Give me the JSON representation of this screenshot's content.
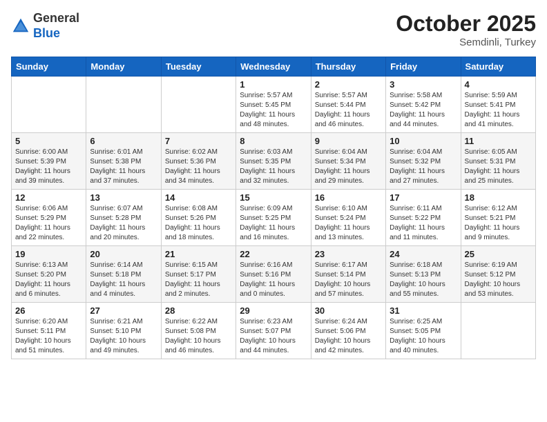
{
  "header": {
    "logo_line1": "General",
    "logo_line2": "Blue",
    "month": "October 2025",
    "location": "Semdinli, Turkey"
  },
  "days_of_week": [
    "Sunday",
    "Monday",
    "Tuesday",
    "Wednesday",
    "Thursday",
    "Friday",
    "Saturday"
  ],
  "weeks": [
    [
      {
        "day": "",
        "content": ""
      },
      {
        "day": "",
        "content": ""
      },
      {
        "day": "",
        "content": ""
      },
      {
        "day": "1",
        "content": "Sunrise: 5:57 AM\nSunset: 5:45 PM\nDaylight: 11 hours\nand 48 minutes."
      },
      {
        "day": "2",
        "content": "Sunrise: 5:57 AM\nSunset: 5:44 PM\nDaylight: 11 hours\nand 46 minutes."
      },
      {
        "day": "3",
        "content": "Sunrise: 5:58 AM\nSunset: 5:42 PM\nDaylight: 11 hours\nand 44 minutes."
      },
      {
        "day": "4",
        "content": "Sunrise: 5:59 AM\nSunset: 5:41 PM\nDaylight: 11 hours\nand 41 minutes."
      }
    ],
    [
      {
        "day": "5",
        "content": "Sunrise: 6:00 AM\nSunset: 5:39 PM\nDaylight: 11 hours\nand 39 minutes."
      },
      {
        "day": "6",
        "content": "Sunrise: 6:01 AM\nSunset: 5:38 PM\nDaylight: 11 hours\nand 37 minutes."
      },
      {
        "day": "7",
        "content": "Sunrise: 6:02 AM\nSunset: 5:36 PM\nDaylight: 11 hours\nand 34 minutes."
      },
      {
        "day": "8",
        "content": "Sunrise: 6:03 AM\nSunset: 5:35 PM\nDaylight: 11 hours\nand 32 minutes."
      },
      {
        "day": "9",
        "content": "Sunrise: 6:04 AM\nSunset: 5:34 PM\nDaylight: 11 hours\nand 29 minutes."
      },
      {
        "day": "10",
        "content": "Sunrise: 6:04 AM\nSunset: 5:32 PM\nDaylight: 11 hours\nand 27 minutes."
      },
      {
        "day": "11",
        "content": "Sunrise: 6:05 AM\nSunset: 5:31 PM\nDaylight: 11 hours\nand 25 minutes."
      }
    ],
    [
      {
        "day": "12",
        "content": "Sunrise: 6:06 AM\nSunset: 5:29 PM\nDaylight: 11 hours\nand 22 minutes."
      },
      {
        "day": "13",
        "content": "Sunrise: 6:07 AM\nSunset: 5:28 PM\nDaylight: 11 hours\nand 20 minutes."
      },
      {
        "day": "14",
        "content": "Sunrise: 6:08 AM\nSunset: 5:26 PM\nDaylight: 11 hours\nand 18 minutes."
      },
      {
        "day": "15",
        "content": "Sunrise: 6:09 AM\nSunset: 5:25 PM\nDaylight: 11 hours\nand 16 minutes."
      },
      {
        "day": "16",
        "content": "Sunrise: 6:10 AM\nSunset: 5:24 PM\nDaylight: 11 hours\nand 13 minutes."
      },
      {
        "day": "17",
        "content": "Sunrise: 6:11 AM\nSunset: 5:22 PM\nDaylight: 11 hours\nand 11 minutes."
      },
      {
        "day": "18",
        "content": "Sunrise: 6:12 AM\nSunset: 5:21 PM\nDaylight: 11 hours\nand 9 minutes."
      }
    ],
    [
      {
        "day": "19",
        "content": "Sunrise: 6:13 AM\nSunset: 5:20 PM\nDaylight: 11 hours\nand 6 minutes."
      },
      {
        "day": "20",
        "content": "Sunrise: 6:14 AM\nSunset: 5:18 PM\nDaylight: 11 hours\nand 4 minutes."
      },
      {
        "day": "21",
        "content": "Sunrise: 6:15 AM\nSunset: 5:17 PM\nDaylight: 11 hours\nand 2 minutes."
      },
      {
        "day": "22",
        "content": "Sunrise: 6:16 AM\nSunset: 5:16 PM\nDaylight: 11 hours\nand 0 minutes."
      },
      {
        "day": "23",
        "content": "Sunrise: 6:17 AM\nSunset: 5:14 PM\nDaylight: 10 hours\nand 57 minutes."
      },
      {
        "day": "24",
        "content": "Sunrise: 6:18 AM\nSunset: 5:13 PM\nDaylight: 10 hours\nand 55 minutes."
      },
      {
        "day": "25",
        "content": "Sunrise: 6:19 AM\nSunset: 5:12 PM\nDaylight: 10 hours\nand 53 minutes."
      }
    ],
    [
      {
        "day": "26",
        "content": "Sunrise: 6:20 AM\nSunset: 5:11 PM\nDaylight: 10 hours\nand 51 minutes."
      },
      {
        "day": "27",
        "content": "Sunrise: 6:21 AM\nSunset: 5:10 PM\nDaylight: 10 hours\nand 49 minutes."
      },
      {
        "day": "28",
        "content": "Sunrise: 6:22 AM\nSunset: 5:08 PM\nDaylight: 10 hours\nand 46 minutes."
      },
      {
        "day": "29",
        "content": "Sunrise: 6:23 AM\nSunset: 5:07 PM\nDaylight: 10 hours\nand 44 minutes."
      },
      {
        "day": "30",
        "content": "Sunrise: 6:24 AM\nSunset: 5:06 PM\nDaylight: 10 hours\nand 42 minutes."
      },
      {
        "day": "31",
        "content": "Sunrise: 6:25 AM\nSunset: 5:05 PM\nDaylight: 10 hours\nand 40 minutes."
      },
      {
        "day": "",
        "content": ""
      }
    ]
  ]
}
